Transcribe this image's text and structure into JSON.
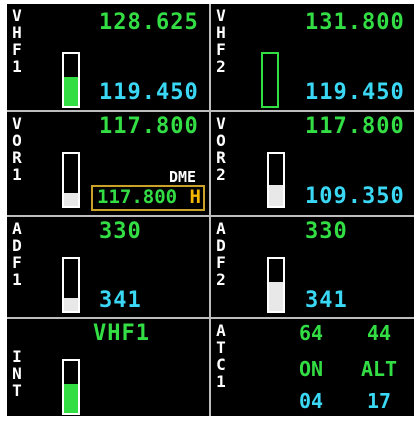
{
  "vhf1": {
    "label": "VHF1",
    "active_freq": "128.625",
    "standby_freq": "119.450",
    "level": 0.55
  },
  "vhf2": {
    "label": "VHF2",
    "active_freq": "131.800",
    "standby_freq": "119.450",
    "level": 0
  },
  "vor1": {
    "label": "VOR1",
    "active_freq": "117.800",
    "dme_label": "DME",
    "dme_freq": "117.800",
    "dme_hold": "H",
    "level": 0.25
  },
  "vor2": {
    "label": "VOR2",
    "active_freq": "117.800",
    "standby_freq": "109.350",
    "level": 0.4
  },
  "adf1": {
    "label": "ADF1",
    "active_freq": "330",
    "standby_freq": "341",
    "level": 0.25
  },
  "adf2": {
    "label": "ADF2",
    "active_freq": "330",
    "standby_freq": "341",
    "level": 0.55
  },
  "int": {
    "label": "INT",
    "source": "VHF1",
    "level": 0.55
  },
  "atc1": {
    "label": "ATC1",
    "code_left": "64",
    "code_right": "44",
    "mode_left": "ON",
    "mode_right": "ALT",
    "sel_left": "04",
    "sel_right": "17"
  },
  "colors": {
    "active": "#33dd44",
    "standby": "#3ad8f5",
    "label": "#ffffff",
    "divider": "#bdbdbd",
    "dme_box": "#c9a227",
    "hold": "#f5b800"
  }
}
